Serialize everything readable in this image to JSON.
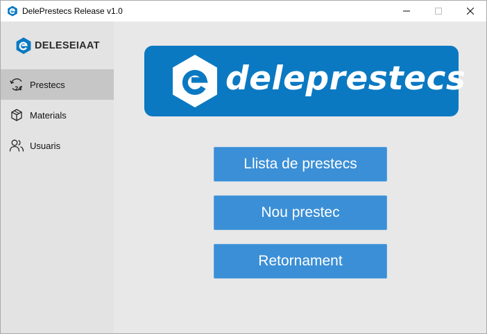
{
  "window": {
    "title": "DelePrestecs Release v1.0",
    "controls": [
      "minimize-icon",
      "maximize-icon",
      "close-icon"
    ]
  },
  "sidebar": {
    "brand": "DELESEIAAT",
    "items": [
      {
        "label": "Prestecs",
        "icon": "refresh-24-icon",
        "active": true
      },
      {
        "label": "Materials",
        "icon": "box-icon",
        "active": false
      },
      {
        "label": "Usuaris",
        "icon": "users-icon",
        "active": false
      }
    ]
  },
  "main": {
    "logo_text": "deleprestecs",
    "buttons": [
      {
        "label": "Llista de prestecs"
      },
      {
        "label": "Nou prestec"
      },
      {
        "label": "Retornament"
      }
    ]
  },
  "colors": {
    "brand_blue": "#0b79c2",
    "button_blue": "#3b8fd6",
    "sidebar_bg": "#e3e3e3",
    "sidebar_active": "#c6c6c6",
    "main_bg": "#e8e8e8"
  }
}
